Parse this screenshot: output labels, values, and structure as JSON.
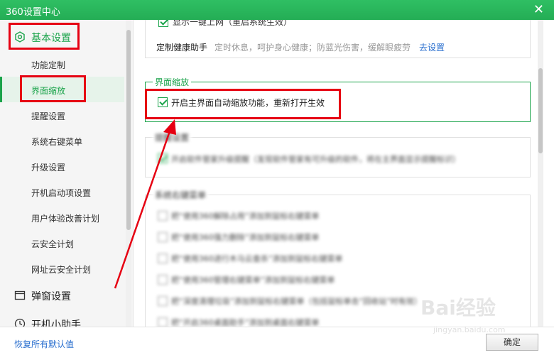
{
  "window": {
    "title": "360设置中心",
    "close_glyph": "✕"
  },
  "sidebar": {
    "categories": [
      {
        "label": "基本设置",
        "icon": "hexagon-gear-icon",
        "active": true
      },
      {
        "label": "弹窗设置",
        "icon": "popup-window-icon",
        "active": false
      },
      {
        "label": "开机小助手",
        "icon": "clock-icon",
        "active": false
      }
    ],
    "items": [
      {
        "label": "功能定制"
      },
      {
        "label": "界面缩放",
        "active": true
      },
      {
        "label": "提醒设置"
      },
      {
        "label": "系统右键菜单"
      },
      {
        "label": "升级设置"
      },
      {
        "label": "开机启动项设置"
      },
      {
        "label": "用户体验改善计划"
      },
      {
        "label": "云安全计划"
      },
      {
        "label": "网址云安全计划"
      }
    ]
  },
  "main": {
    "top_group": {
      "partial_option": "显示一键上网（重启系统生效）",
      "health_label": "定制健康助手",
      "health_desc": "定时休息，呵护身心健康；防蓝光伤害，缓解眼疲劳",
      "health_link": "去设置"
    },
    "zoom_group": {
      "title": "界面缩放",
      "option": "开启主界面自动缩放功能，重新打开生效",
      "checked": true
    },
    "blurred_group_1": {
      "title": "提醒设置",
      "option": "开启软件管家升级提醒（发现软件管家有可升级的软件，将在主界面显示提醒标识）"
    },
    "blurred_group_2": {
      "title": "系统右键菜单",
      "items": [
        "把“使用360解除占用”添加到鼠标右键菜单",
        "把“使用360强力删除”添加到鼠标右键菜单",
        "把“使用360进行木马云查杀”添加到鼠标右键菜单",
        "把“使用360管理右键菜单”添加到鼠标右键菜单",
        "把“深度清理垃圾”添加到鼠标右键菜单（包括鼠标单击“回收站”时有效）",
        "把“开启360桌面助手”添加到桌面右键菜单"
      ]
    }
  },
  "footer": {
    "restore_label": "恢复所有默认值",
    "ok_label": "确定"
  },
  "watermark": {
    "brand": "Bai经验",
    "url": "jingyan.baidu.com"
  },
  "colors": {
    "accent": "#1aa34a",
    "titlebar": "#24ad55",
    "annotation": "#e60012",
    "link": "#2a6fcf"
  }
}
